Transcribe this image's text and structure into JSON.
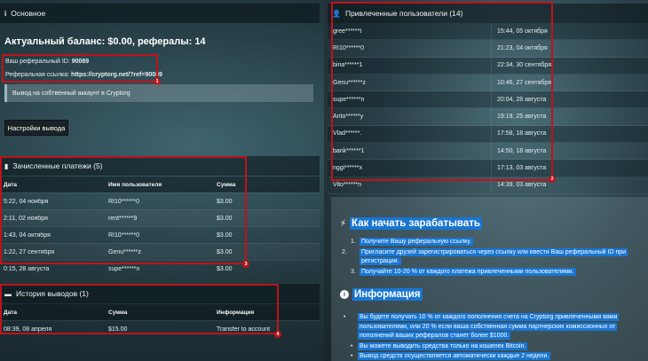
{
  "main": {
    "header": "Основное",
    "balance_line": "Актуальный баланс: $0.00, рефералы: 14",
    "ref_id_label": "Ваш реферальный ID:",
    "ref_id_value": "90089",
    "ref_link_label": "Реферальная ссылка:",
    "ref_link_value": "https://cryptorg.net/?ref=90089",
    "notice": "Вывод на собтвенный аккаунт в Cryptorg",
    "settings_button": "Настройки вывода"
  },
  "payments": {
    "header": "Зачисленные платежи (5)",
    "columns": [
      "Дата",
      "Имя пользователя",
      "Сумма"
    ],
    "rows": [
      {
        "date": "5:22, 04 ноября",
        "user": "RI10******0",
        "amount": "$3.00"
      },
      {
        "date": "2:11, 02 ноября",
        "user": "rent******9",
        "amount": "$3.00"
      },
      {
        "date": "1:43, 04 октября",
        "user": "RI10******0",
        "amount": "$3.00"
      },
      {
        "date": "1:22, 27 сентября",
        "user": "Genu******z",
        "amount": "$3.00"
      },
      {
        "date": "0:15, 28 августа",
        "user": "supe******n",
        "amount": "$3.00"
      }
    ]
  },
  "withdrawals": {
    "header": "История выводов (1)",
    "columns": [
      "Дата",
      "Сумма",
      "Информация"
    ],
    "rows": [
      {
        "date": "08:39, 08 апреля",
        "amount": "$15.00",
        "info": "Transfer to account"
      }
    ]
  },
  "referrals": {
    "header": "Привлеченные пользователи (14)",
    "rows": [
      {
        "user": "gree******t",
        "time": "15:44, 05 октября"
      },
      {
        "user": "RI10******0",
        "time": "21:23, 04 октября"
      },
      {
        "user": "bina******1",
        "time": "22:34, 30 сентября"
      },
      {
        "user": "Genu******z",
        "time": "10:46, 27 сентября"
      },
      {
        "user": "supe******n",
        "time": "20:04, 28 августа"
      },
      {
        "user": "Anto******y",
        "time": "19:19, 25 августа"
      },
      {
        "user": "Vlad******.",
        "time": "17:58, 18 августа"
      },
      {
        "user": "bank******1",
        "time": "14:50, 18 августа"
      },
      {
        "user": "nggi******x",
        "time": "17:13, 03 августа"
      },
      {
        "user": "Vito******n",
        "time": "14:39, 03 августа"
      }
    ]
  },
  "earn": {
    "title": "Как начать зарабатывать",
    "steps": [
      "Получите Вашу реферальную ссылку.",
      "Пригласите друзей зарегистрироваться через ссылку или ввести Ваш реферальный ID при регистрации.",
      "Получайте 10-20 % от каждого платежа привлеченными пользователями."
    ]
  },
  "information": {
    "title": "Информация",
    "items": [
      "Вы будете получать 10 % от каждого пополнения счета на Cryptorg привлеченными вами пользователями, или 20 % если ваша собственная сумма партнерских комиссионных от пополнений ваших рефералов станет более $1000.",
      "Вы можете выводить средства только на кошелек Bitcoin.",
      "Вывод средств осуществляется автоматически каждые 2 недели."
    ]
  },
  "annotations": [
    "1",
    "2",
    "3",
    "4"
  ],
  "colors": {
    "accent": "#1976d2",
    "annotation": "#c0121a"
  }
}
